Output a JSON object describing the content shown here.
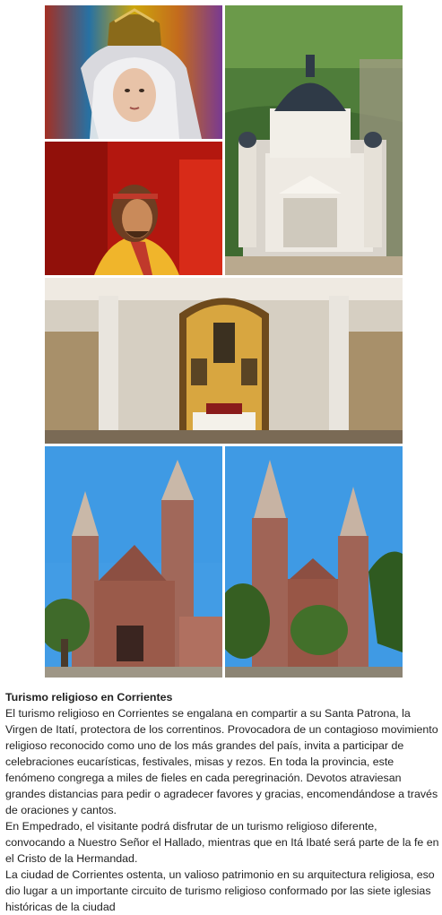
{
  "images": {
    "virgin": {
      "icon": "virgin-statue-photo"
    },
    "christ": {
      "icon": "christ-statue-photo"
    },
    "basilica": {
      "icon": "basilica-aerial-photo"
    },
    "altar": {
      "icon": "church-altar-interior-photo"
    },
    "church_left": {
      "icon": "red-brick-church-photo"
    },
    "church_right": {
      "icon": "red-brick-church-photo"
    }
  },
  "article": {
    "title": "Turismo religioso en Corrientes",
    "paragraphs": [
      "El turismo religioso en Corrientes se engalana en compartir a su Santa Patrona, la Virgen de Itatí, protectora de los correntinos. Provocadora de un contagioso movimiento religioso reconocido como uno de los más grandes del país, invita a participar de celebraciones eucarísticas, festivales, misas y rezos. En toda la provincia, este fenómeno congrega a miles de fieles en cada peregrinación. Devotos atraviesan grandes distancias para pedir o agradecer favores y gracias, encomendándose a través de oraciones y cantos.",
      "En Empedrado, el visitante podrá disfrutar de un turismo religioso diferente, convocando a Nuestro Señor el Hallado, mientras que en Itá Ibaté será parte de la fe en el Cristo de la Hermandad.",
      "La ciudad de Corrientes ostenta, un valioso patrimonio en su arquitectura religiosa, eso dio lugar a un importante circuito de turismo religioso conformado por las siete iglesias históricas de la ciudad"
    ]
  },
  "colors": {
    "text": "#222222",
    "sky": "#3f9ae4",
    "brick": "#9a5a4a",
    "gold": "#d8a640"
  }
}
